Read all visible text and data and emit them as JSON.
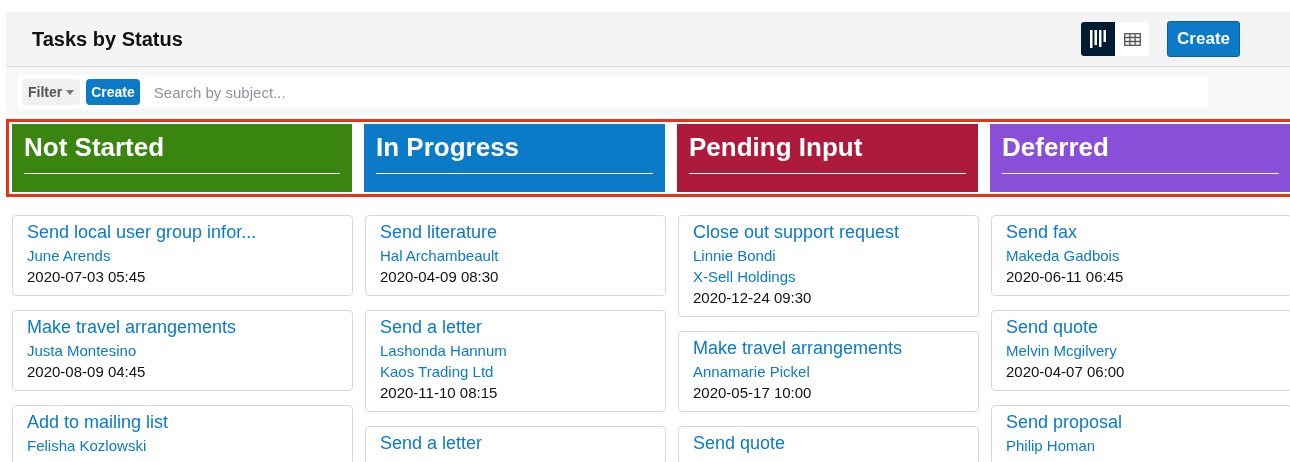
{
  "header": {
    "title": "Tasks by Status",
    "views": [
      {
        "kind": "board",
        "selected": true
      },
      {
        "kind": "table",
        "selected": false
      }
    ],
    "create_button": "Create"
  },
  "toolbar": {
    "filter": "Filter",
    "create_button": "Create",
    "search": {
      "placeholder": "Search by subject..."
    }
  },
  "columns": [
    {
      "name": "Not Started",
      "color": "#3a850f",
      "cards": [
        {
          "title": "Send local user group infor...",
          "links": [
            "June Arends"
          ],
          "date": "2020-07-03 05:45"
        },
        {
          "title": "Make travel arrangements",
          "links": [
            "Justa Montesino"
          ],
          "date": "2020-08-09 04:45"
        },
        {
          "title": "Add to mailing list",
          "links": [
            "Felisha Kozlowski"
          ]
        }
      ]
    },
    {
      "name": "In Progress",
      "color": "#0b7ac7",
      "cards": [
        {
          "title": "Send literature",
          "links": [
            "Hal Archambeault"
          ],
          "date": "2020-04-09 08:30"
        },
        {
          "title": "Send a letter",
          "links": [
            "Lashonda Hannum",
            "Kaos Trading Ltd"
          ],
          "date": "2020-11-10 08:15"
        },
        {
          "title": "Send a letter"
        }
      ]
    },
    {
      "name": "Pending Input",
      "color": "#ad1a3c",
      "cards": [
        {
          "title": "Close out support request",
          "links": [
            "Linnie Bondi",
            "X-Sell Holdings"
          ],
          "date": "2020-12-24 09:30"
        },
        {
          "title": "Make travel arrangements",
          "links": [
            "Annamarie Pickel"
          ],
          "date": "2020-05-17 10:00"
        },
        {
          "title": "Send quote"
        }
      ]
    },
    {
      "name": "Deferred",
      "color": "#8a4fd8",
      "cards": [
        {
          "title": "Send fax",
          "links": [
            "Makeda Gadbois"
          ],
          "date": "2020-06-11 06:45"
        },
        {
          "title": "Send quote",
          "links": [
            "Melvin Mcgilvery"
          ],
          "date": "2020-04-07 06:00"
        },
        {
          "title": "Send proposal",
          "links": [
            "Philip Homan"
          ]
        }
      ]
    }
  ]
}
